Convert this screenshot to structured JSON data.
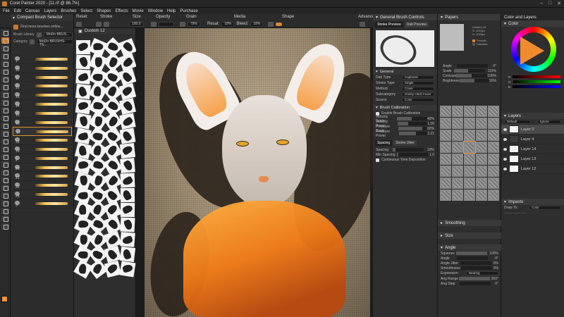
{
  "window": {
    "title": "Corel Painter 2020 - [11.rif @ 86.7%]"
  },
  "menu": [
    "File",
    "Edit",
    "Canvas",
    "Layers",
    "Brushes",
    "Select",
    "Shapes",
    "Effects",
    "Movie",
    "Window",
    "Help",
    "Purchase"
  ],
  "property_bar": {
    "reset": "Reset",
    "stroke": "Stroke",
    "size": "Size",
    "size_value": "100.0",
    "opacity": "Opacity",
    "grain": "Grain",
    "grain_value": "78%",
    "media": "Media",
    "media_resat": "Resat:",
    "media_resat_value": "18%",
    "media_bleed": "Bleed:",
    "media_bleed_value": "18%",
    "shape": "Shape",
    "advanced": "Advanced"
  },
  "brush_selector": {
    "title": "Compact Brush Selector",
    "find_more": "Find more brushes online...",
    "library_label": "Brush Library",
    "library_value": "MoDo BRUS...",
    "category_label": "Category",
    "category_value": "MoDo BRUSHS-TS...",
    "variants": [
      {
        "label": "1"
      },
      {
        "label": "10"
      },
      {
        "label": "11"
      },
      {
        "label": "12"
      },
      {
        "label": "13"
      },
      {
        "label": "14"
      },
      {
        "label": "15"
      },
      {
        "label": "16"
      },
      {
        "label": "17"
      },
      {
        "label": "18"
      },
      {
        "label": "19"
      },
      {
        "label": "2"
      },
      {
        "label": "20"
      },
      {
        "label": "21"
      },
      {
        "label": "22"
      },
      {
        "label": "23"
      },
      {
        "label": "3"
      }
    ],
    "selected_index": 8
  },
  "custom_panel": {
    "title": "Custom 12",
    "dab_count": 64
  },
  "brush_controls": {
    "title": "General Brush Controls",
    "tabs": [
      "Stroke Preview",
      "Dab Preview"
    ],
    "general": "General",
    "dab_type_label": "Dab Type",
    "dab_type_value": "Captured",
    "stroke_type_label": "Stroke Type",
    "stroke_type_value": "Single",
    "method_label": "Method",
    "method_value": "Cover",
    "subcategory_label": "Subcategory",
    "subcategory_value": "Grainy Hard Cover",
    "source_label": "Source",
    "source_value": "Color",
    "calibration": "Brush Calibration",
    "enable_calibration": "Enable Brush Calibration",
    "velocity_scale": "Velocity Scale",
    "velocity_scale_value": "49%",
    "velocity_power": "Velocity Power",
    "velocity_power_value": "1.26",
    "pressure_scale": "Pressure Scale",
    "pressure_scale_value": "82%",
    "pressure_power": "Pressure Power",
    "pressure_power_value": "2.21",
    "spacing_tabs": [
      "Spacing",
      "Stroke Jitter"
    ],
    "spacing_label": "Spacing",
    "spacing_value": "10%",
    "min_spacing_label": "Min Spacing",
    "min_spacing_value": "1.0",
    "continuous": "Continuous Time Deposition"
  },
  "papers": {
    "title": "Papers",
    "info": [
      "Untitled-15",
      "S: 1216px",
      "H: 1049px"
    ],
    "angle_label": "Angle",
    "angle_value": "0°",
    "scale_label": "Scale",
    "scale_value": "115%",
    "contrast_label": "Contrast",
    "contrast_value": "100%",
    "brightness_label": "Brightness",
    "brightness_value": "50%",
    "smooth": "Smooth",
    "direction": "Direction",
    "tile_count": 40
  },
  "smoothing": {
    "title": "Smoothing"
  },
  "size_panel": {
    "title": "Size"
  },
  "angle_panel": {
    "title": "Angle",
    "squeeze_label": "Squeeze",
    "squeeze_value": "100%",
    "angle_label": "Angle",
    "angle_value": "0°",
    "jitter_label": "Angle Jitter",
    "jitter_value": "0%",
    "smooth_label": "Smoothness",
    "smooth_value": "0%",
    "expression_label": "Expression",
    "expression_value": "Bearing",
    "range_label": "Ang Range",
    "range_value": "360°",
    "step_label": "Ang Step",
    "step_value": "0°"
  },
  "color_panel": {
    "title": "Color and Layers",
    "color_tab": "Color",
    "main_color": "#f19539"
  },
  "layers": {
    "title": "Layers",
    "composite": "Default",
    "ignore": "Ignore",
    "items": [
      {
        "name": "Layer 3",
        "selected": true
      },
      {
        "name": "Layer 4",
        "selected": false
      },
      {
        "name": "Layer 14",
        "selected": false
      },
      {
        "name": "Layer 13",
        "selected": false
      },
      {
        "name": "Layer 12",
        "selected": false
      }
    ]
  },
  "impasto": {
    "title": "Impasto",
    "draw_to_label": "Draw To:",
    "draw_to_value": "Color"
  }
}
